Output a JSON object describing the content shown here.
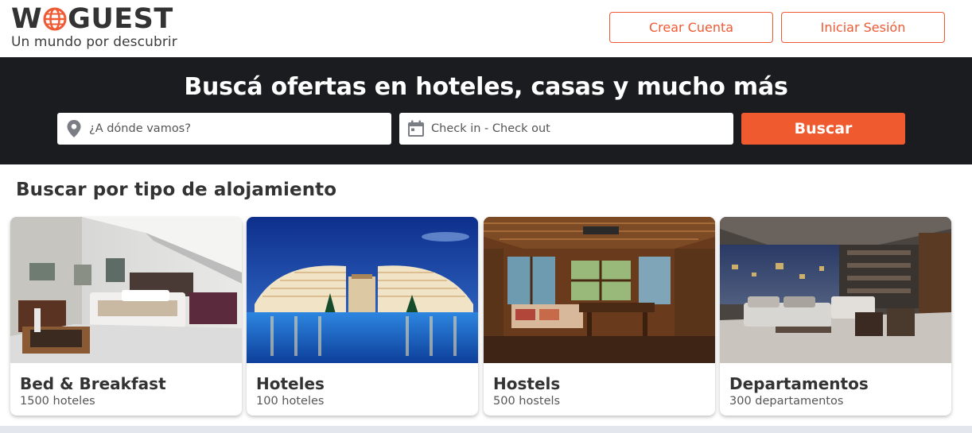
{
  "brand": {
    "logo_left": "W",
    "logo_right": "GUEST",
    "tagline": "Un mundo por descubrir",
    "logo_icon": "globe-icon",
    "accent_color": "#ef5a33"
  },
  "header": {
    "create_account_label": "Crear Cuenta",
    "login_label": "Iniciar Sesión"
  },
  "search": {
    "title": "Buscá ofertas en hoteles, casas y mucho más",
    "destination_placeholder": "¿A dónde vamos?",
    "destination_icon": "location-pin-icon",
    "dates_placeholder": "Check in - Check out",
    "dates_icon": "calendar-icon",
    "submit_label": "Buscar",
    "band_color": "#1b1c1f"
  },
  "categories": {
    "title": "Buscar por tipo de alojamiento",
    "items": [
      {
        "name": "Bed & Breakfast",
        "count": "1500 hoteles"
      },
      {
        "name": "Hoteles",
        "count": "100 hoteles"
      },
      {
        "name": "Hostels",
        "count": "500 hostels"
      },
      {
        "name": "Departamentos",
        "count": "300 departamentos"
      }
    ]
  }
}
